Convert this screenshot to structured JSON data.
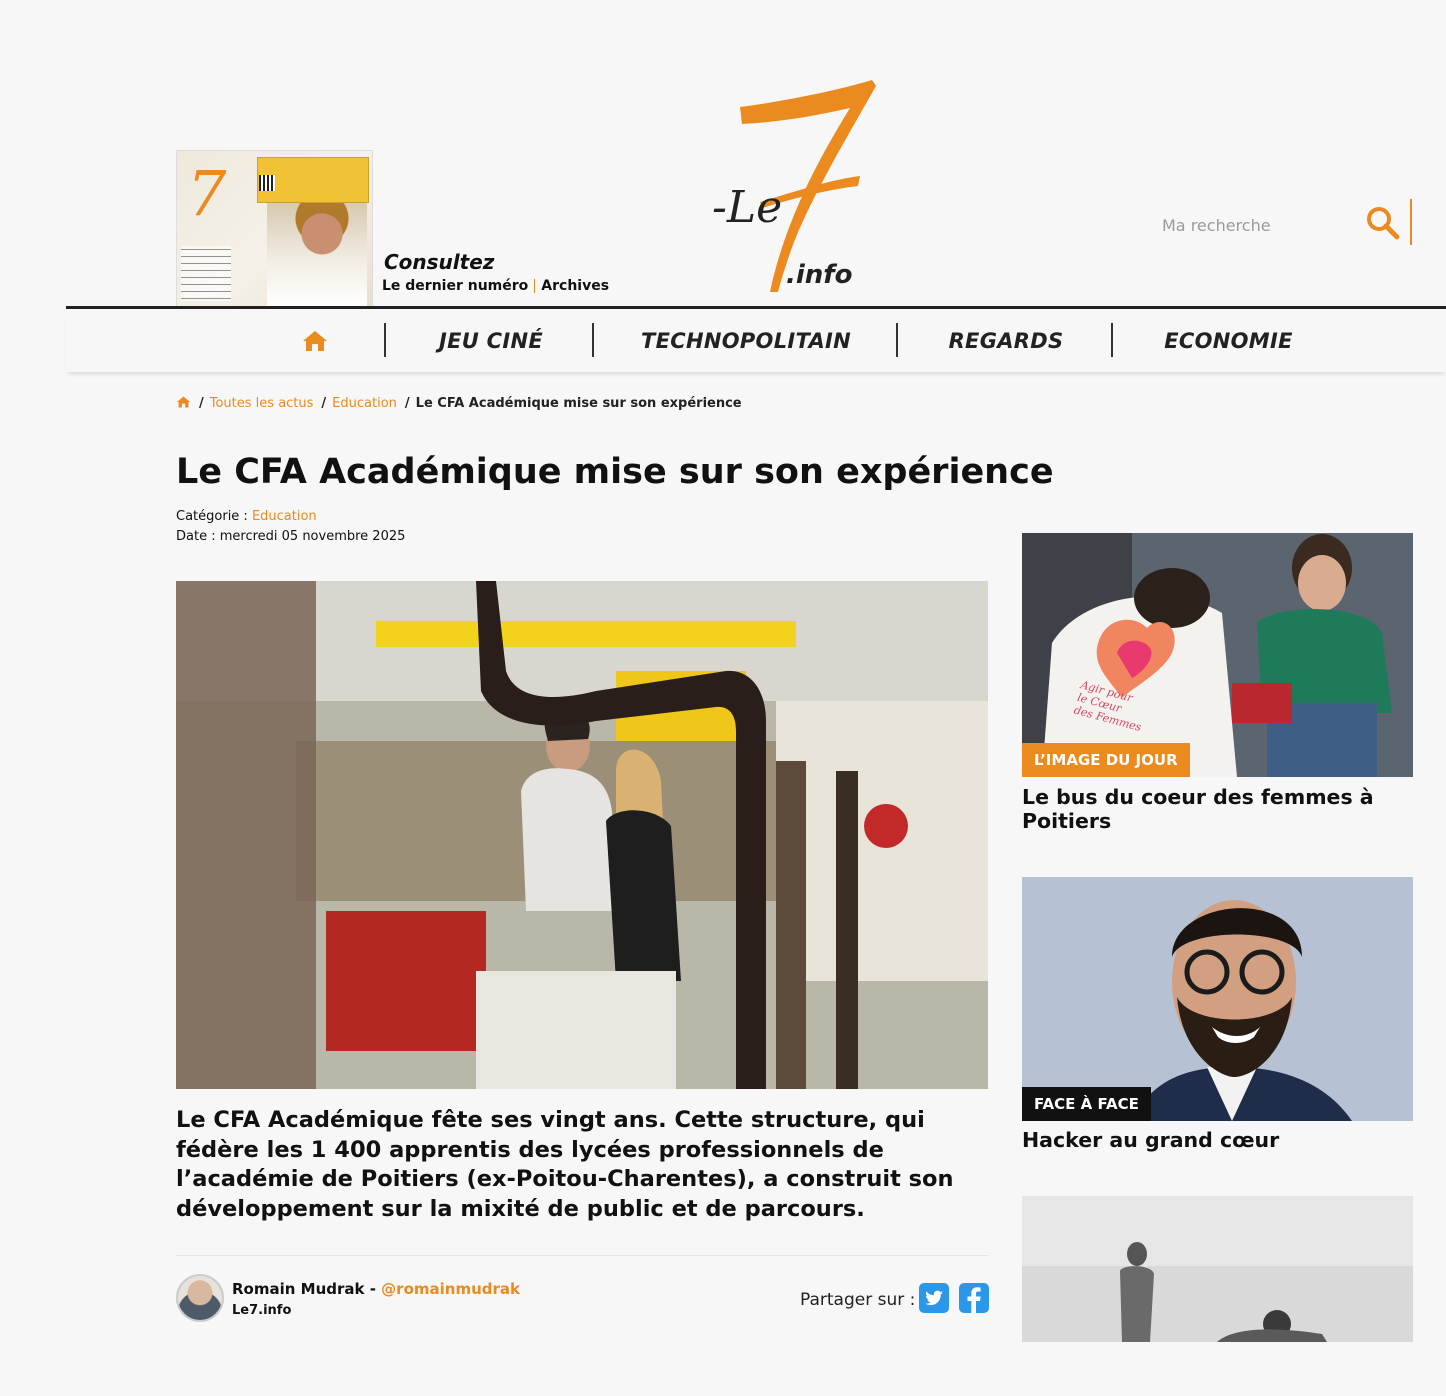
{
  "header": {
    "magazine_cta": "Consultez",
    "latest_issue_link": "Le dernier numéro",
    "archives_link": "Archives",
    "logo": {
      "mark": "7",
      "prefix": "-Le",
      "suffix": ".info",
      "accent_color": "#ea8a1f"
    },
    "search": {
      "placeholder": "Ma recherche",
      "icon": "search-icon"
    }
  },
  "nav": {
    "home_icon": "home-icon",
    "items": [
      {
        "label": "JEU CINÉ"
      },
      {
        "label": "TECHNOPOLITAIN"
      },
      {
        "label": "REGARDS"
      },
      {
        "label": "ECONOMIE"
      }
    ]
  },
  "breadcrumb": {
    "home_icon": "home-icon",
    "items": [
      "Toutes les actus",
      "Education"
    ],
    "current": "Le CFA Académique mise sur son expérience"
  },
  "article": {
    "title": "Le CFA Académique mise sur son expérience",
    "category_label": "Catégorie : ",
    "category": "Education",
    "date_label": "Date : ",
    "date": "mercredi 05 novembre 2025",
    "lead": "Le CFA Académique fête ses vingt ans. Cette structure, qui fédère les 1 400 apprentis des lycées professionnels de l’académie de Poitiers (ex-Poitou-Charentes), a construit son développement sur la mixité de public et de parcours."
  },
  "author": {
    "name": "Romain Mudrak",
    "separator": " - ",
    "handle": "@romainmudrak",
    "site": "Le7.info"
  },
  "share": {
    "label": "Partager sur :",
    "networks": [
      "twitter",
      "facebook"
    ]
  },
  "sidebar": {
    "cards": [
      {
        "badge": "L’IMAGE DU JOUR",
        "title": "Le bus du coeur des femmes à Poitiers",
        "shirt_text": "Agir pour le Cœur des Femmes"
      },
      {
        "badge": "FACE À FACE",
        "title": "Hacker au grand cœur"
      },
      {
        "badge": "",
        "title": ""
      }
    ]
  },
  "colors": {
    "accent": "#ea8a1f",
    "share_blue": "#2a97e8",
    "text": "#111111"
  }
}
